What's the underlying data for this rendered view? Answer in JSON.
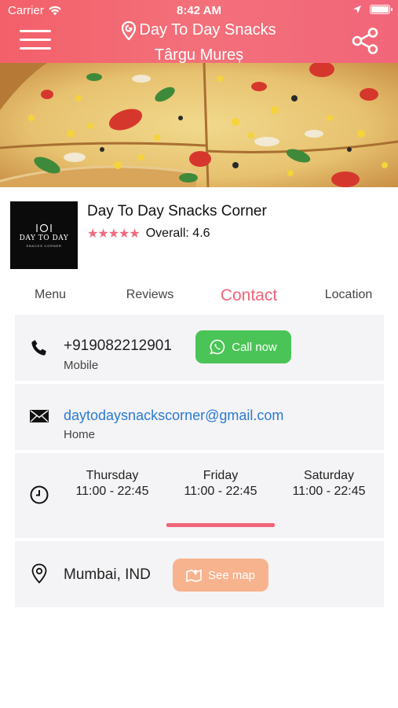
{
  "status_bar": {
    "carrier": "Carrier",
    "time": "8:42 AM"
  },
  "header": {
    "title_line1": "Day To Day Snacks",
    "title_line2": "Târgu Mureș",
    "menu_icon": "hamburger-menu-icon",
    "location_icon": "location-pin-icon",
    "share_icon": "share-icon"
  },
  "restaurant": {
    "logo": {
      "mark": "DAY TO DAY",
      "sub": "SNACKS CORNER"
    },
    "name": "Day To Day Snacks Corner",
    "stars": "★★★★★",
    "overall": "Overall: 4.6"
  },
  "tabs": [
    {
      "label": "Menu",
      "active": false
    },
    {
      "label": "Reviews",
      "active": false
    },
    {
      "label": "Contact",
      "active": true
    },
    {
      "label": "Location",
      "active": false
    }
  ],
  "contact": {
    "phone": {
      "number": "+919082212901",
      "type": "Mobile",
      "call_label": "Call now",
      "icon": "phone-icon",
      "call_icon": "whatsapp-icon"
    },
    "email": {
      "address": "daytodaysnackscorner@gmail.com",
      "type": "Home",
      "icon": "envelope-icon"
    },
    "hours": {
      "icon": "clock-icon",
      "days": [
        {
          "day": "Thursday",
          "hours": "11:00 - 22:45"
        },
        {
          "day": "Friday",
          "hours": "11:00 - 22:45",
          "selected": true
        },
        {
          "day": "Saturday",
          "hours": "11:00 - 22:45"
        }
      ]
    },
    "address": {
      "text": "Mumbai, IND",
      "map_label": "See map",
      "icon": "location-pin-icon",
      "map_icon": "map-icon"
    }
  },
  "colors": {
    "header": "#f3606a",
    "accent": "#f0647a",
    "call_button": "#4ac456",
    "map_button": "#f7b38e",
    "link": "#2a7bd6",
    "card_bg": "#f4f3f5"
  }
}
